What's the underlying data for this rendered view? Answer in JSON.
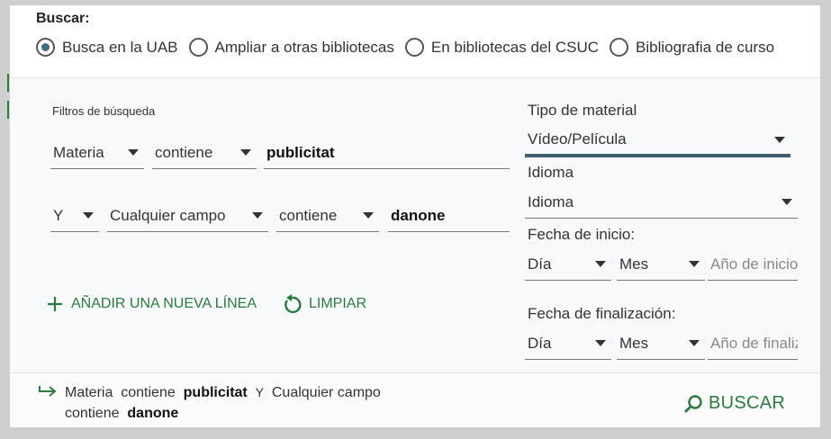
{
  "scope": {
    "label": "Buscar:",
    "options": [
      {
        "label": "Busca en la UAB",
        "selected": true
      },
      {
        "label": "Ampliar a otras bibliotecas",
        "selected": false
      },
      {
        "label": "En bibliotecas del CSUC",
        "selected": false
      },
      {
        "label": "Bibliografia de curso",
        "selected": false
      }
    ]
  },
  "filters": {
    "title": "Filtros de búsqueda",
    "rows": [
      {
        "operator": "",
        "field": "Materia",
        "condition": "contiene",
        "value": "publicitat"
      },
      {
        "operator": "Y",
        "field": "Cualquier campo",
        "condition": "contiene",
        "value": "danone"
      }
    ],
    "add_line_label": "AÑADIR UNA NUEVA LÍNEA",
    "clear_label": "LIMPIAR"
  },
  "side": {
    "material_type_label": "Tipo de material",
    "material_type_value": "Vídeo/Película",
    "language_label": "Idioma",
    "language_value": "Idioma",
    "start_date_label": "Fecha de inicio:",
    "start_day": "Día",
    "start_month": "Mes",
    "start_year_placeholder": "Año de inicio",
    "end_date_label": "Fecha de finalización:",
    "end_day": "Día",
    "end_month": "Mes",
    "end_year_placeholder": "Año de finalización"
  },
  "summary": {
    "row1_field": "Materia",
    "row1_condition": "contiene",
    "row1_value": "publicitat",
    "row2_operator": "Y",
    "row2_field": "Cualquier campo",
    "row2_condition": "contiene",
    "row2_value": "danone",
    "search_label": "BUSCAR"
  },
  "colors": {
    "accent_green": "#2b7a3f",
    "radio_selected": "#3a6f85",
    "active_underline": "#3f5d6e"
  }
}
